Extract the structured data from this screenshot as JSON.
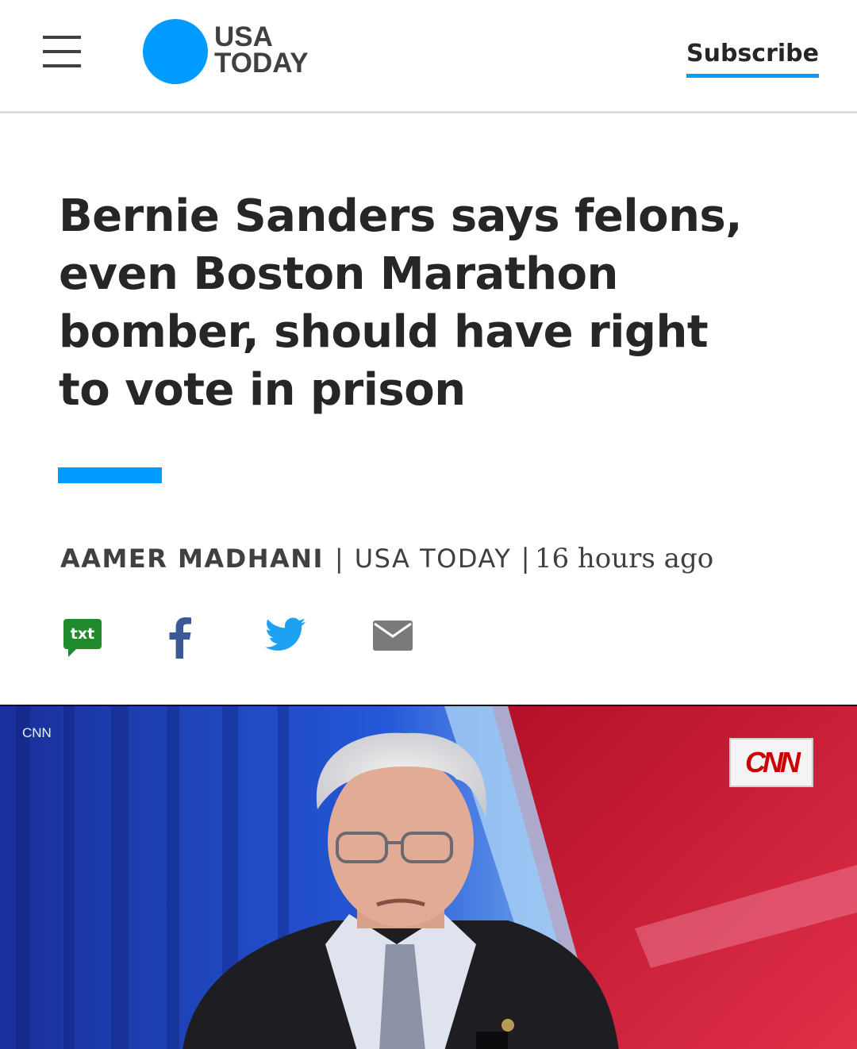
{
  "header": {
    "menu_icon": "hamburger-menu-icon",
    "logo_line1": "USA",
    "logo_line2": "TODAY",
    "subscribe_label": "Subscribe",
    "brand_color": "#009bff"
  },
  "article": {
    "headline_lines": [
      "Bernie Sanders says felons,",
      "even Boston Marathon",
      "bomber, should have right",
      "to vote in prison"
    ],
    "author": "AAMER MADHANI",
    "separator": "|",
    "source": "USA TODAY",
    "time": "16 hours ago"
  },
  "share": {
    "txt_label": "txt",
    "icons": [
      "sms-txt-icon",
      "facebook-icon",
      "twitter-icon",
      "email-icon"
    ],
    "txt_color": "#1f8b2c",
    "facebook_color": "#3b5998",
    "twitter_color": "#1da1f2",
    "email_color": "#7a7a7a"
  },
  "photo": {
    "credit": "CNN",
    "network_logo": "CNN"
  }
}
